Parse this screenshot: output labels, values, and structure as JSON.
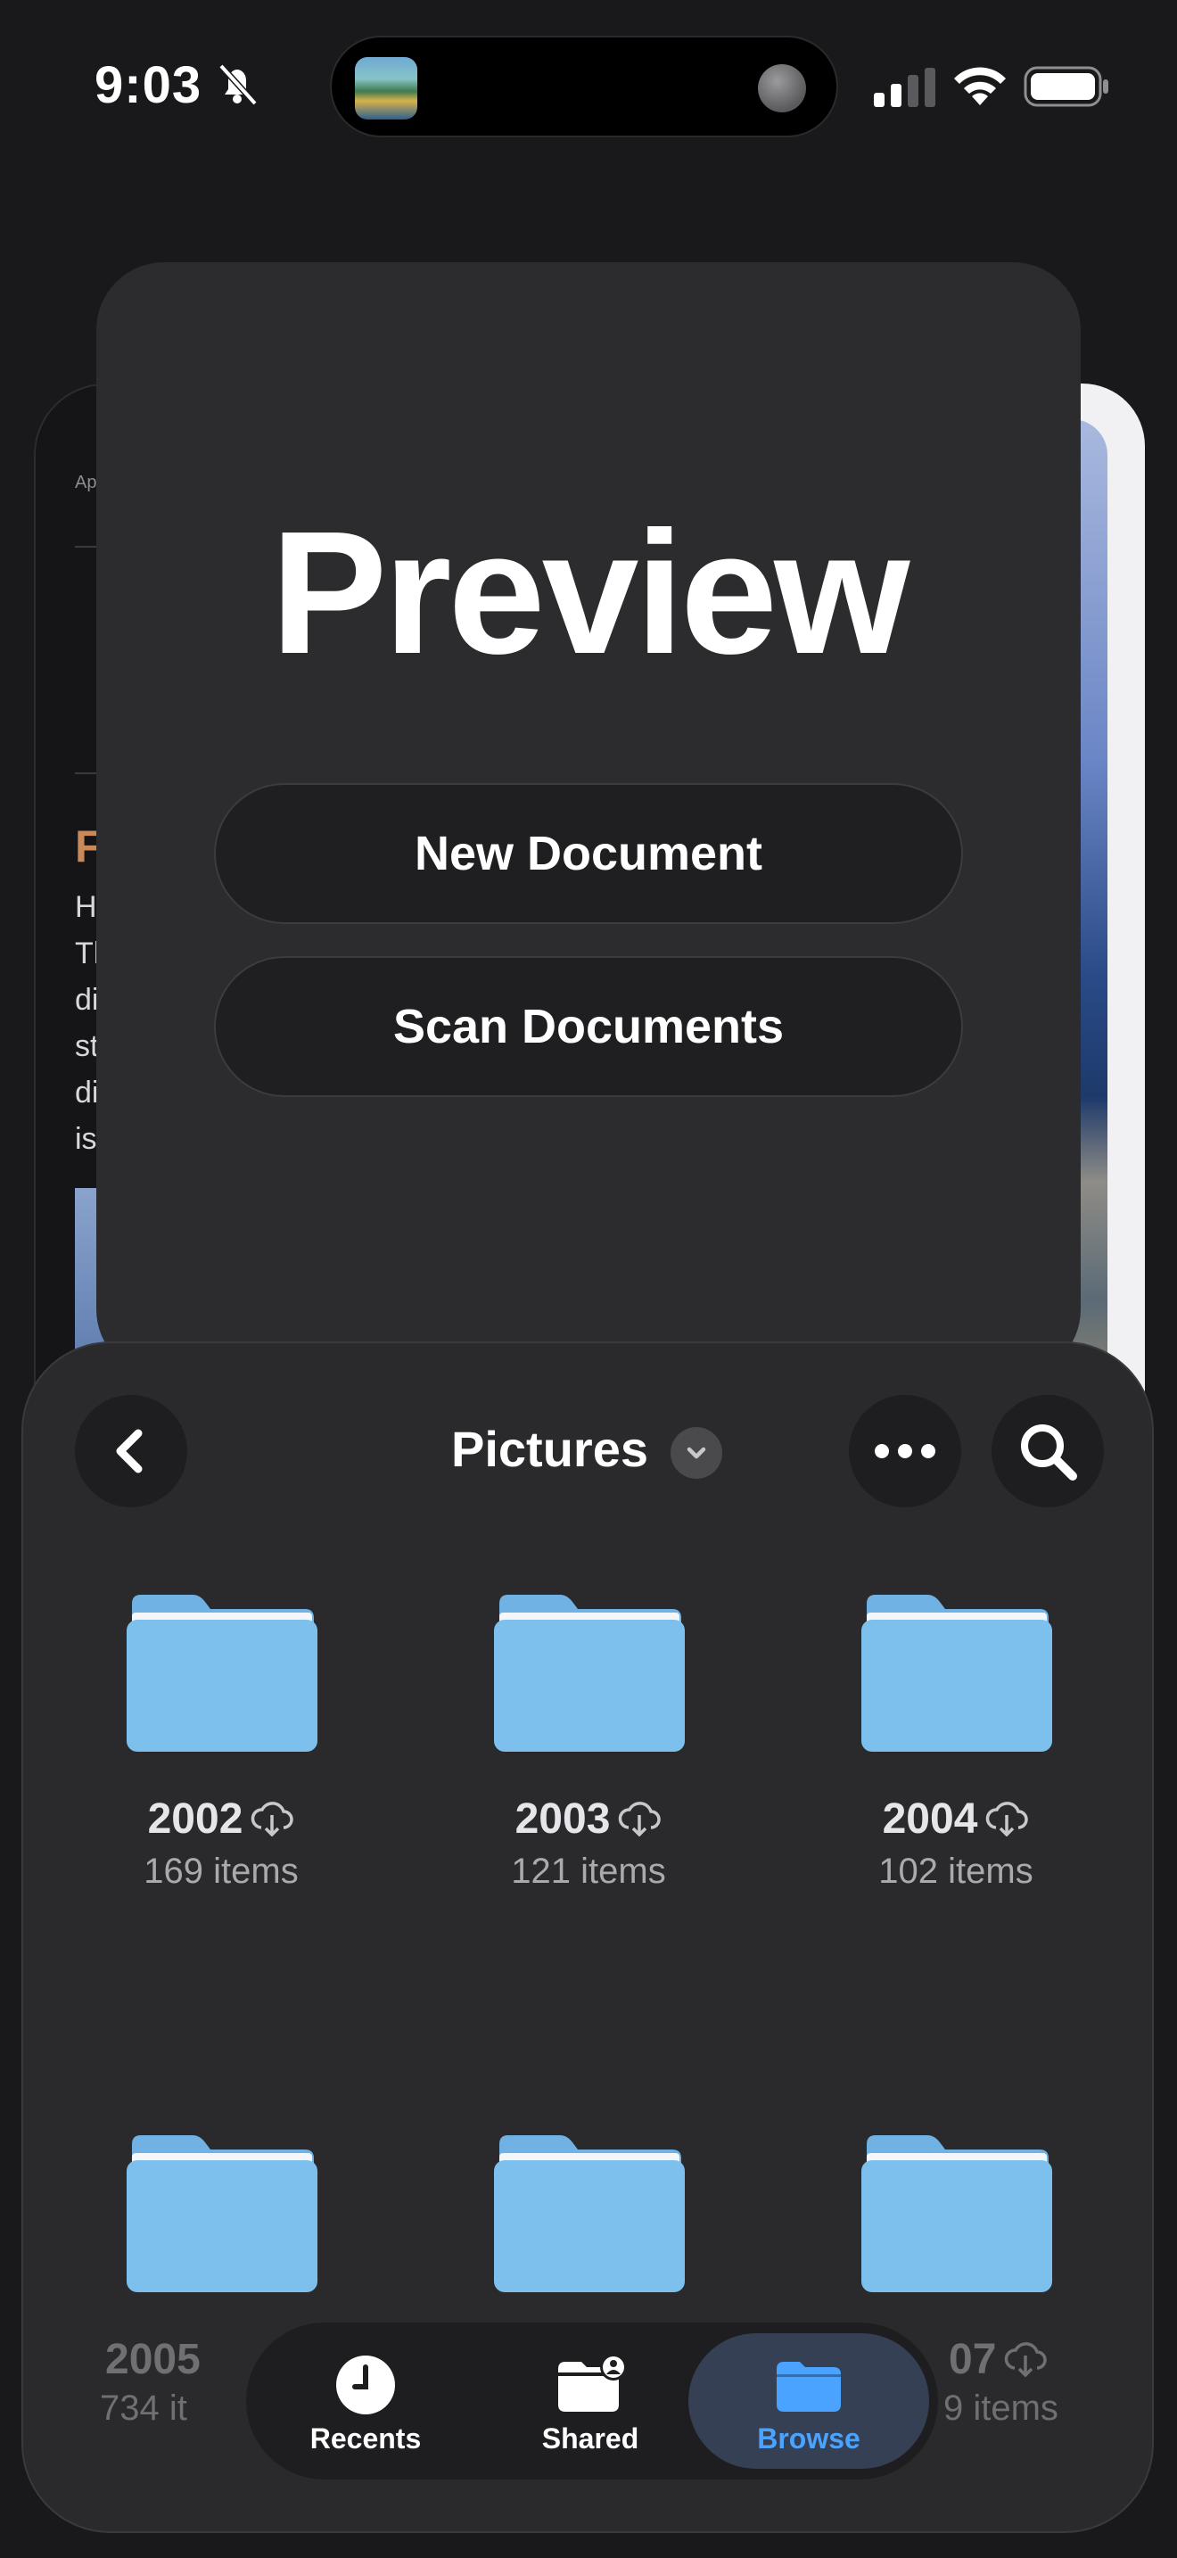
{
  "status_bar": {
    "time": "9:03"
  },
  "preview": {
    "title": "Preview",
    "new_document": "New Document",
    "scan_documents": "Scan Documents"
  },
  "background_card": {
    "tiny_label": "Ap",
    "heading_letter": "F",
    "lines": [
      "H",
      "Th",
      "di",
      "st",
      "di",
      "is"
    ]
  },
  "files": {
    "title": "Pictures",
    "folders": [
      {
        "name": "2002",
        "count": "169 items"
      },
      {
        "name": "2003",
        "count": "121 items"
      },
      {
        "name": "2004",
        "count": "102 items"
      },
      {
        "name": "2005",
        "count": "734 it"
      },
      {
        "name": "",
        "count": ""
      },
      {
        "name": "07",
        "count": "9 items"
      }
    ]
  },
  "tabbar": {
    "recents": "Recents",
    "shared": "Shared",
    "browse": "Browse"
  },
  "colors": {
    "accent": "#4aa3ff",
    "folder": "#7cc0ec",
    "background": "#19191b"
  }
}
